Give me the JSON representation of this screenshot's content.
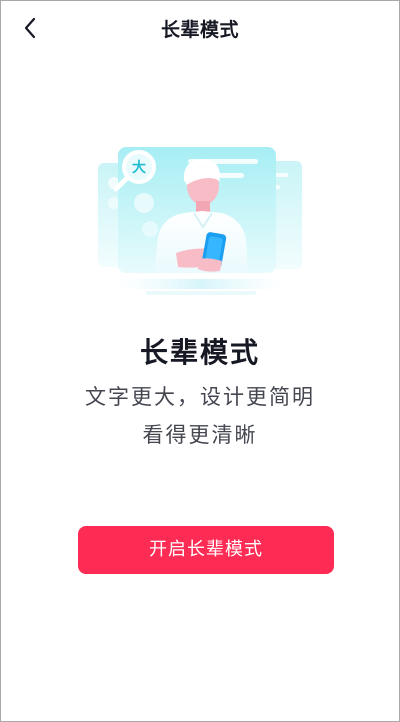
{
  "nav": {
    "title": "长辈模式",
    "back_icon": "chevron-left-icon"
  },
  "hero": {
    "illustration": "elder-mode-illustration",
    "magnifier_char": "大"
  },
  "content": {
    "title": "长辈模式",
    "desc_line1": "文字更大，设计更简明",
    "desc_line2": "看得更清晰"
  },
  "cta": {
    "label": "开启长辈模式",
    "color": "#fe2c55"
  }
}
